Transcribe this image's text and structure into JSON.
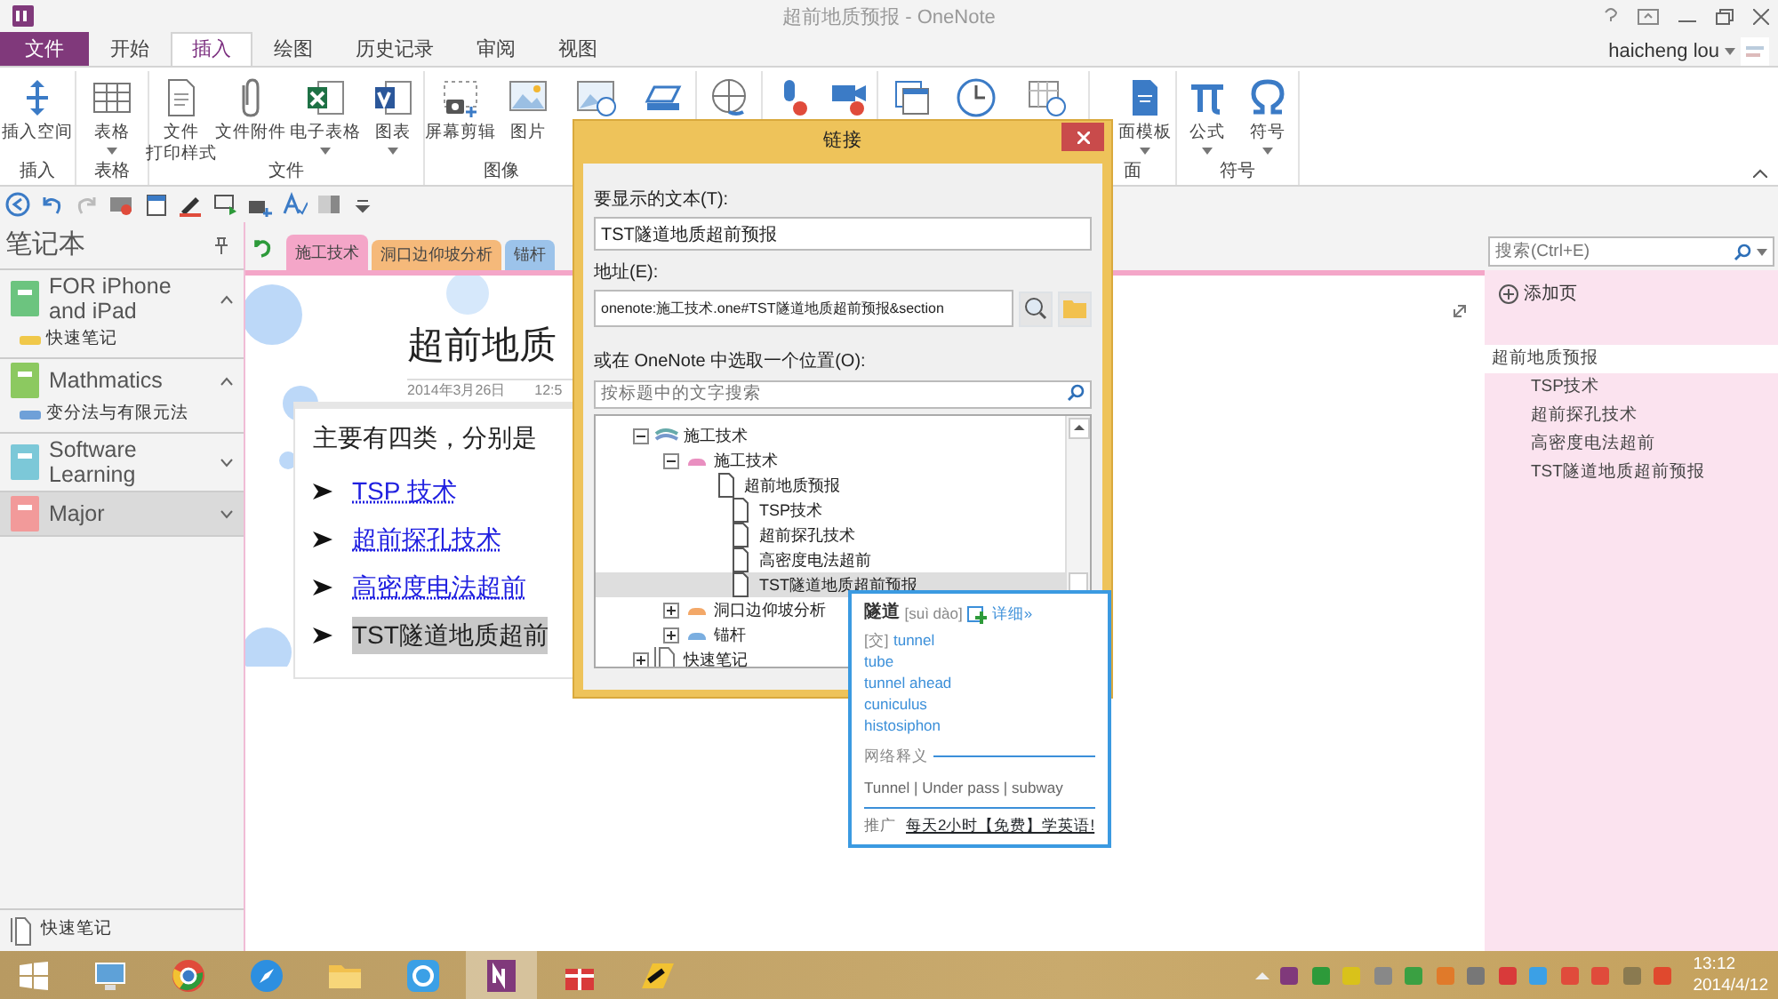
{
  "window": {
    "title": "超前地质预报 - OneNote",
    "user": "haicheng lou"
  },
  "ribbon_tabs": [
    {
      "label": "文件",
      "kind": "file",
      "selected": false
    },
    {
      "label": "开始",
      "kind": "tab",
      "selected": false
    },
    {
      "label": "插入",
      "kind": "tab",
      "selected": true
    },
    {
      "label": "绘图",
      "kind": "tab",
      "selected": false
    },
    {
      "label": "历史记录",
      "kind": "tab",
      "selected": false
    },
    {
      "label": "审阅",
      "kind": "tab",
      "selected": false
    },
    {
      "label": "视图",
      "kind": "tab",
      "selected": false
    }
  ],
  "ribbon_groups": [
    {
      "label": "插入",
      "buttons": [
        {
          "kind": "labeled",
          "label": "插入空间"
        }
      ]
    },
    {
      "label": "表格",
      "buttons": [
        {
          "kind": "labeled",
          "label": "表格",
          "dropdown": true
        }
      ]
    },
    {
      "label": "文件",
      "buttons": [
        {
          "kind": "labeled",
          "label_lines": [
            "文件",
            "打印样式"
          ]
        },
        {
          "kind": "labeled",
          "label": "文件附件"
        },
        {
          "kind": "labeled",
          "label": "电子表格",
          "dropdown": true
        },
        {
          "kind": "labeled",
          "label": "图表",
          "dropdown": true
        }
      ]
    },
    {
      "label": "图像",
      "buttons": [
        {
          "kind": "labeled",
          "label": "屏幕剪辑"
        },
        {
          "kind": "labeled",
          "label": "图片"
        },
        {
          "kind": "icon"
        },
        {
          "kind": "icon"
        }
      ]
    },
    {
      "buttons": [
        {
          "kind": "icon"
        }
      ]
    },
    {
      "buttons": [
        {
          "kind": "icon"
        },
        {
          "kind": "icon"
        }
      ]
    },
    {
      "buttons": [
        {
          "kind": "icon"
        },
        {
          "kind": "icon"
        },
        {
          "kind": "icon"
        }
      ]
    },
    {
      "label": "面",
      "buttons": [
        {
          "kind": "labeled",
          "label": "面模板",
          "dropdown": true
        }
      ]
    },
    {
      "label": "符号",
      "buttons": [
        {
          "kind": "labeled",
          "label": "公式",
          "dropdown": true
        },
        {
          "kind": "labeled",
          "label": "符号",
          "dropdown": true
        }
      ]
    }
  ],
  "sidebar": {
    "title": "笔记本",
    "notebooks": [
      {
        "name": "FOR iPhone and iPad",
        "color": "#6cc47f",
        "expanded": true,
        "selected": false,
        "sections": [
          {
            "name": "快速笔记",
            "color": "#f0c84a"
          }
        ]
      },
      {
        "name": "Mathmatics",
        "color": "#8cc960",
        "expanded": true,
        "selected": false,
        "sections": [
          {
            "name": "变分法与有限元法",
            "color": "#6fa0d8"
          }
        ]
      },
      {
        "name": "Software Learning",
        "color": "#7cc8d8",
        "expanded": false,
        "selected": false
      },
      {
        "name": "Major",
        "color": "#f29a9a",
        "expanded": false,
        "selected": true
      }
    ],
    "footer": "快速笔记"
  },
  "section_tabs": [
    {
      "label": "施工技术",
      "color": "#f4a6c8",
      "selected": true
    },
    {
      "label": "洞口边仰坡分析",
      "color": "#f5b97a",
      "selected": false
    },
    {
      "label": "锚杆",
      "color": "#9cc3ea",
      "selected": false
    }
  ],
  "page": {
    "title": "超前地质",
    "date": "2014年3月26日",
    "time": "12:5",
    "intro": "主要有四类，分别是",
    "items": [
      {
        "text": "TSP 技术",
        "kind": "link",
        "selected": false
      },
      {
        "text": "超前探孔技术",
        "kind": "link",
        "selected": false
      },
      {
        "text": "高密度电法超前",
        "kind": "link",
        "selected": false
      },
      {
        "text": "TST隧道地质超前",
        "kind": "plain",
        "selected": true
      }
    ]
  },
  "page_pane": {
    "search_placeholder": "搜索(Ctrl+E)",
    "add_page": "添加页",
    "pages": [
      {
        "title": "超前地质预报",
        "selected": true,
        "children": [
          {
            "title": "TSP技术",
            "selected": false
          },
          {
            "title": "超前探孔技术",
            "selected": false
          },
          {
            "title": "高密度电法超前",
            "selected": false
          },
          {
            "title": "TST隧道地质超前预报",
            "selected": false
          }
        ]
      }
    ]
  },
  "dialog": {
    "title": "链接",
    "text_label": "要显示的文本(T):",
    "text_value": "TST隧道地质超前预报",
    "address_label": "地址(E):",
    "address_value": "onenote:施工技术.one#TST隧道地质超前预报&section",
    "location_label": "或在 OneNote 中选取一个位置(O):",
    "search_placeholder": "按标题中的文字搜索",
    "tree": [
      {
        "label": "施工技术",
        "kind": "notebook",
        "expanded": true,
        "selected": false,
        "children": [
          {
            "label": "施工技术",
            "kind": "section",
            "color": "#e98fc0",
            "expanded": true,
            "selected": false,
            "children": [
              {
                "label": "超前地质预报",
                "kind": "page",
                "selected": false,
                "children": [
                  {
                    "label": "TSP技术",
                    "kind": "page",
                    "selected": false
                  },
                  {
                    "label": "超前探孔技术",
                    "kind": "page",
                    "selected": false
                  },
                  {
                    "label": "高密度电法超前",
                    "kind": "page",
                    "selected": false
                  },
                  {
                    "label": "TST隧道地质超前预报",
                    "kind": "page",
                    "selected": true
                  }
                ]
              }
            ]
          },
          {
            "label": "洞口边仰坡分析",
            "kind": "section",
            "color": "#f3a868",
            "expanded": false,
            "selected": false
          },
          {
            "label": "锚杆",
            "kind": "section",
            "color": "#7aaee0",
            "expanded": false,
            "selected": false
          }
        ]
      },
      {
        "label": "快速笔记",
        "kind": "quick",
        "expanded": false,
        "selected": false
      }
    ]
  },
  "dictionary_popup": {
    "word": "隧道",
    "pinyin": "[suì dào]",
    "more": "详细»",
    "tag": "[交]",
    "meanings": [
      "tunnel",
      "tube",
      "tunnel ahead",
      "cuniculus",
      "histosiphon"
    ],
    "web_heading": "网络释义",
    "web_meanings": "Tunnel | Under pass | subway",
    "promo_label": "推广",
    "promo": "每天2小时【免费】学英语!"
  },
  "taskbar": {
    "apps": [
      {
        "selected": false
      },
      {
        "selected": false
      },
      {
        "selected": false
      },
      {
        "selected": false
      },
      {
        "selected": false
      },
      {
        "selected": true
      },
      {
        "selected": false
      },
      {
        "selected": false
      }
    ],
    "time": "13:12",
    "date": "2014/4/12"
  }
}
